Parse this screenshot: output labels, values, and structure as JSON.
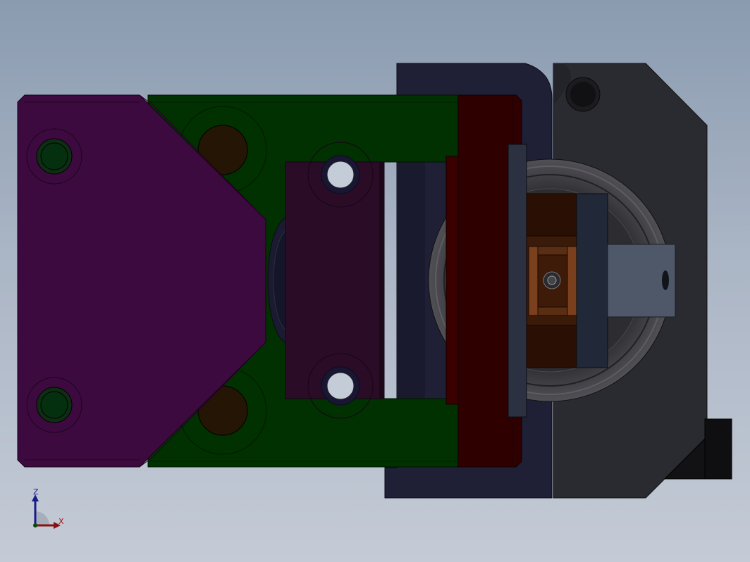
{
  "viewport": {
    "background_top": "#8a9bb0",
    "background_bottom": "#c4cbd6"
  },
  "parts": {
    "purple_plate": "#3c0a3f",
    "green_bracket": "#013001",
    "red_plate": "#2f0000",
    "navy_housing": "#1f1f35",
    "gray_housing": "#2a2b31",
    "copper_core": "#3a1a08",
    "steel_tab": "#4e5868"
  },
  "triad": {
    "z_label": "Z",
    "x_label": "X",
    "z_color": "#1a1aa0",
    "x_color": "#b01010",
    "icon": "coordinate-triad-icon"
  }
}
